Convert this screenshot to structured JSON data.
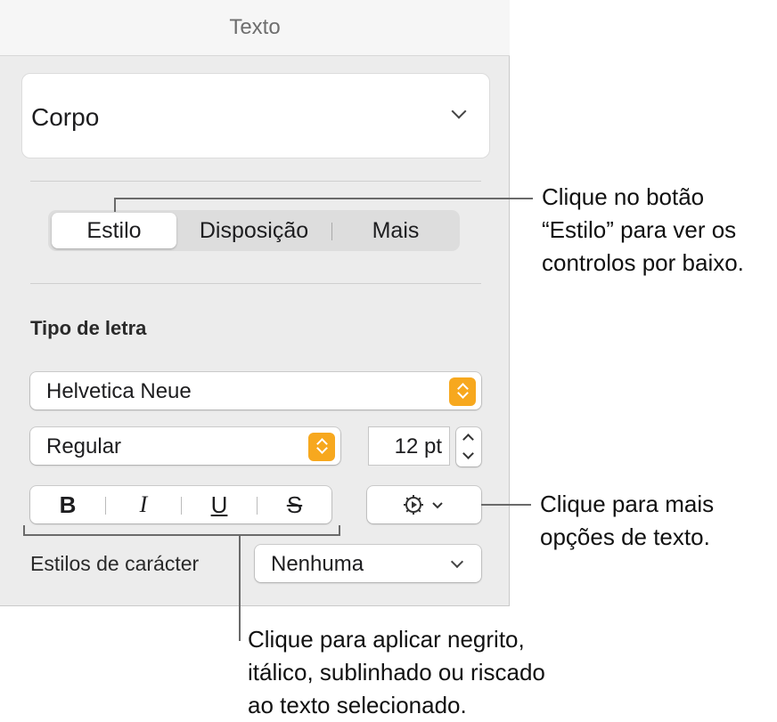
{
  "panel": {
    "title": "Texto",
    "paragraph_style": "Corpo",
    "tabs": [
      {
        "label": "Estilo",
        "active": true
      },
      {
        "label": "Disposição",
        "active": false
      },
      {
        "label": "Mais",
        "active": false
      }
    ],
    "font_section_label": "Tipo de letra",
    "font_family": "Helvetica Neue",
    "font_style": "Regular",
    "font_size": "12 pt",
    "format_buttons": {
      "bold": "B",
      "italic": "I",
      "underline": "U",
      "strike": "S"
    },
    "character_styles_label": "Estilos de carácter",
    "character_styles_value": "Nenhuma",
    "accent_color": "#f7a81e"
  },
  "callouts": {
    "tabs": [
      "Clique no botão",
      "“Estilo” para ver os",
      "controlos por baixo."
    ],
    "options": [
      "Clique para mais",
      "opções de texto."
    ],
    "format": [
      "Clique para aplicar negrito,",
      "itálico, sublinhado ou riscado",
      "ao texto selecionado."
    ]
  }
}
